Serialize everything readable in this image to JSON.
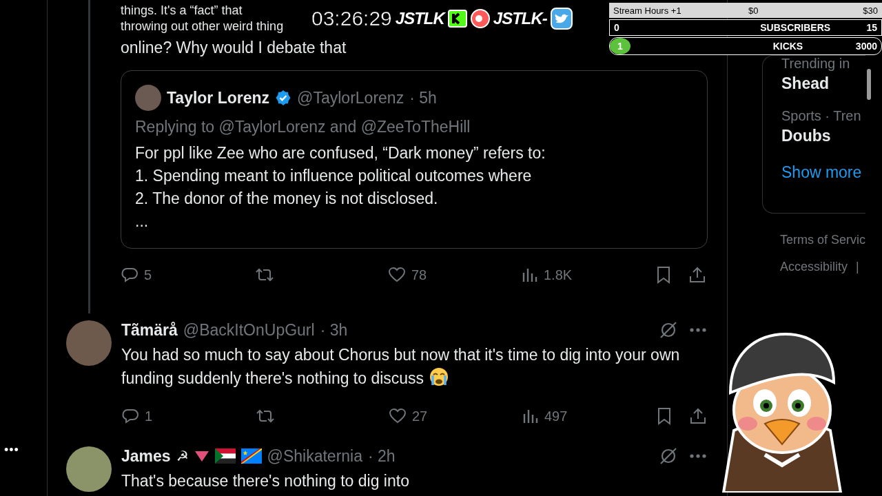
{
  "tweet_text": {
    "line_1": "things. It's a “fact” that",
    "line_2": "throwing out other weird thing",
    "line_3": "online? Why would I debate that"
  },
  "overlay": {
    "timestamp": "03:26:29",
    "logos": [
      {
        "text": "JSTLK",
        "kind": "kick"
      },
      {
        "text": "JSTLK-",
        "kind": "twitter"
      }
    ],
    "stats": [
      {
        "kind": "header",
        "label": "Stream Hours +1",
        "start": "$0",
        "goal": "$30"
      },
      {
        "kind": "bar",
        "label": "SUBSCRIBERS",
        "start": "0",
        "goal": "15"
      },
      {
        "kind": "pill",
        "label": "KICKS",
        "start": "1",
        "goal": "3000"
      }
    ]
  },
  "quoted_tweet": {
    "name": "Taylor Lorenz",
    "verified": true,
    "handle": "@TaylorLorenz",
    "time": "· 5h",
    "replying_to": "Replying to @TaylorLorenz and @ZeeToTheHill",
    "lines": [
      "For ppl like Zee who are confused, “Dark money” refers to:",
      "1. Spending meant to influence political outcomes where",
      "2. The donor of the money is not disclosed.",
      "..."
    ]
  },
  "actions": {
    "replies": "5",
    "likes": "78",
    "views": "1.8K"
  },
  "replies": [
    {
      "name": "Tãmärå",
      "handle": "@BackItOnUpGurl",
      "time": "· 3h",
      "text": "You had so much to say about Chorus but now that it's time to dig into your own funding suddenly there's nothing to discuss",
      "crying_emoji": true,
      "actions": {
        "replies": "1",
        "likes": "27",
        "views": "497"
      }
    },
    {
      "name": "James",
      "badges": [
        {
          "kind": "hammer-sickle",
          "text": "☭"
        },
        {
          "kind": "triangle"
        },
        {
          "kind": "flag-sudan"
        },
        {
          "kind": "flag-congo"
        }
      ],
      "handle": "@Shikaternia",
      "time": "· 2h",
      "text": "That's because there's nothing to dig into",
      "crying_emoji": false
    }
  ],
  "sidebar": {
    "trends": [
      {
        "context": "Trending in",
        "name": "Shead"
      },
      {
        "context": "Sports · Tren",
        "name": "Doubs"
      }
    ],
    "show_more": "Show more",
    "footer": [
      "Terms of Servic",
      "Accessibility",
      "|"
    ]
  },
  "left_more": "•••"
}
